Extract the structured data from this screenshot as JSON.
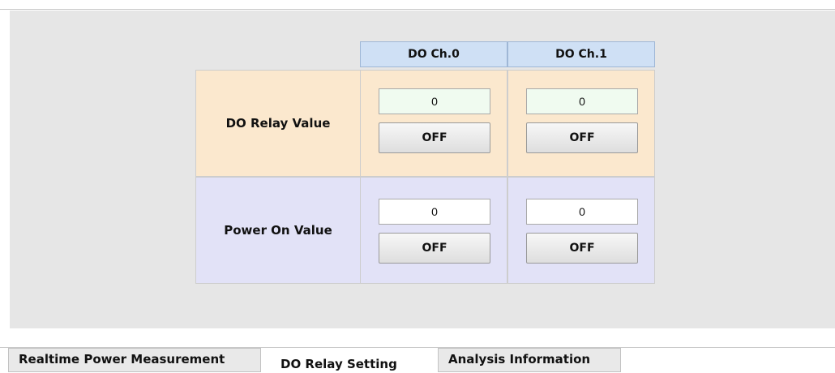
{
  "table": {
    "columns": [
      "DO Ch.0",
      "DO Ch.1"
    ],
    "rows": [
      {
        "label": "DO Relay Value",
        "values": [
          "0",
          "0"
        ],
        "buttons": [
          "OFF",
          "OFF"
        ]
      },
      {
        "label": "Power On Value",
        "values": [
          "0",
          "0"
        ],
        "buttons": [
          "OFF",
          "OFF"
        ]
      }
    ]
  },
  "tabs": [
    {
      "label": "Realtime Power Measurement",
      "active": false
    },
    {
      "label": "DO Relay Setting",
      "active": true
    },
    {
      "label": "Analysis Information",
      "active": false
    }
  ],
  "colors": {
    "header_bg": "#cfe0f5",
    "relay_row_bg": "#fbe8ce",
    "power_row_bg": "#e2e2f7",
    "panel_bg": "#e6e6e6"
  }
}
